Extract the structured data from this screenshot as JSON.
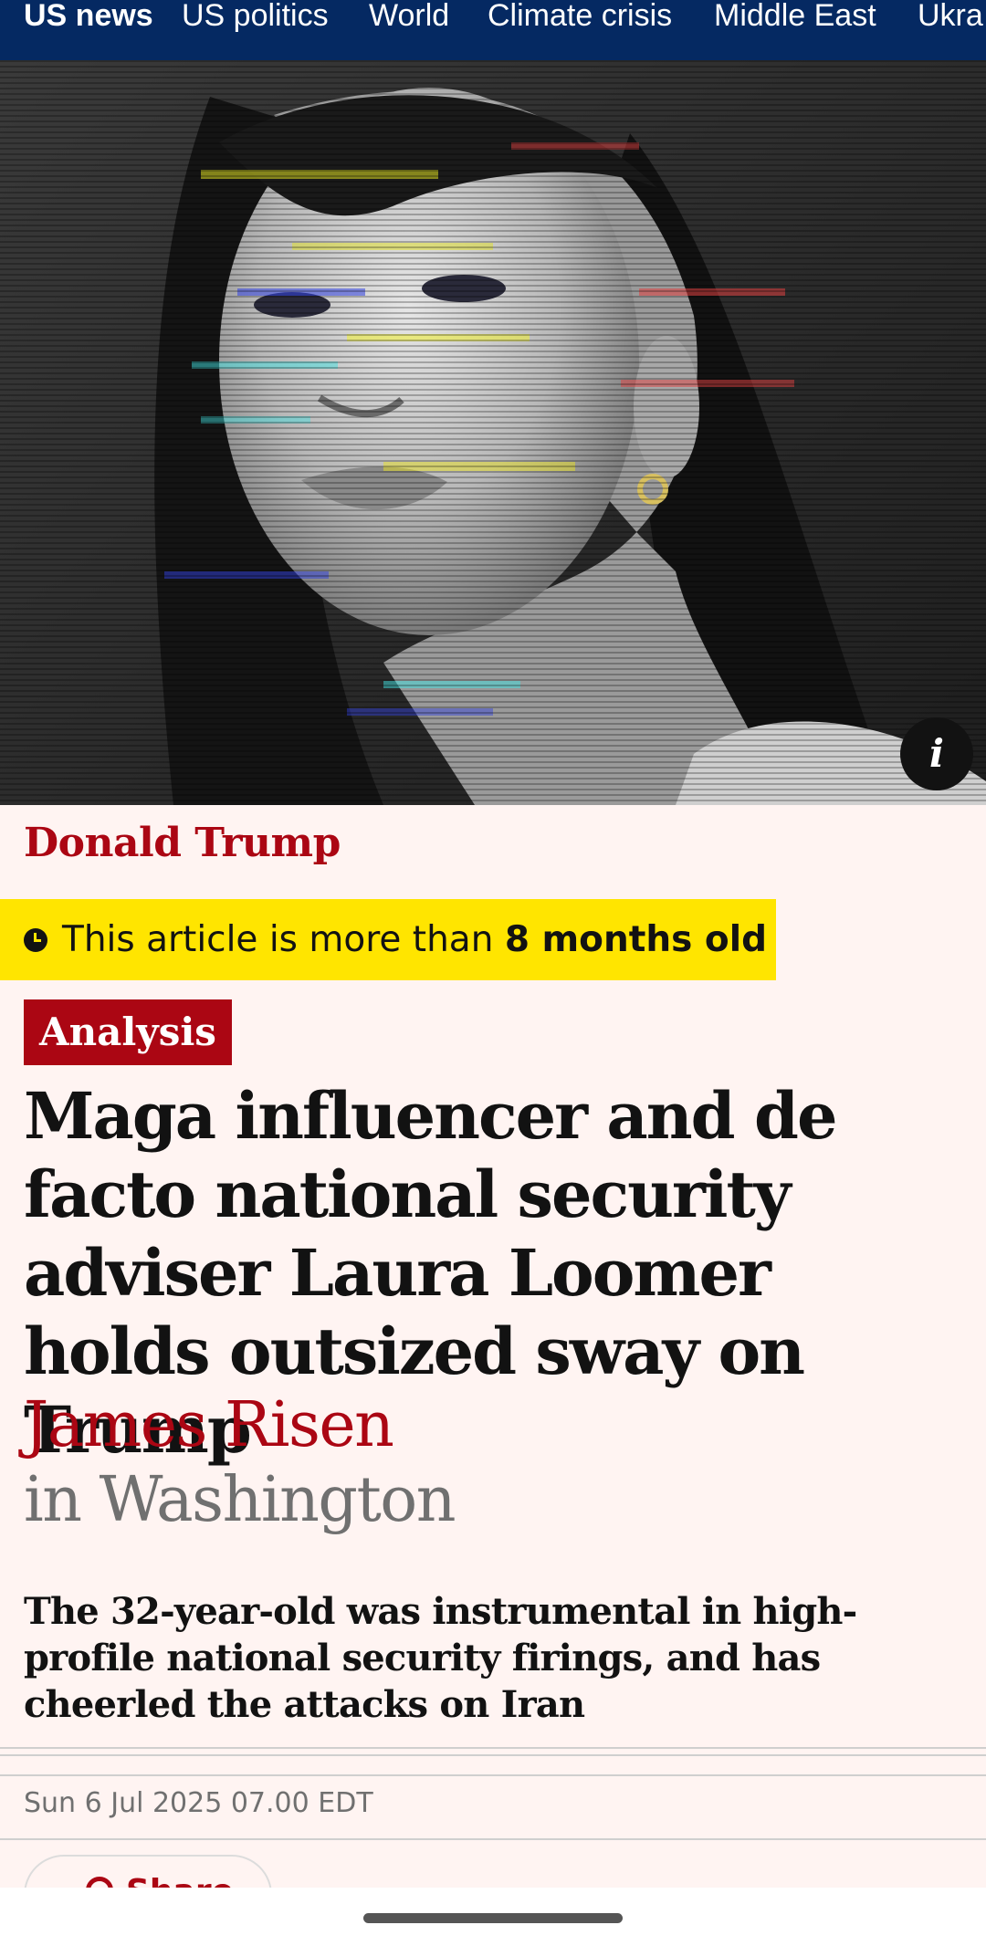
{
  "nav": {
    "items": [
      {
        "label": "US news",
        "active": true
      },
      {
        "label": "US politics",
        "active": false
      },
      {
        "label": "World",
        "active": false
      },
      {
        "label": "Climate crisis",
        "active": false
      },
      {
        "label": "Middle East",
        "active": false
      },
      {
        "label": "Ukra",
        "active": false
      }
    ]
  },
  "hero": {
    "info_icon": "i"
  },
  "article": {
    "kicker": "Donald Trump",
    "age_notice": {
      "prefix": "This article is more than ",
      "emphasis": "8 months old",
      "icon": "clock-icon"
    },
    "label": "Analysis",
    "headline": "Maga influencer and de facto national security adviser Laura Loomer holds outsized sway on Trump",
    "author": "James Risen",
    "location": "in Washington",
    "standfirst": "The 32-year-old was instrumental in high-profile national security firings, and has cheerled the attacks on Iran",
    "dateline": "Sun 6 Jul 2025 07.00 EDT",
    "share_label": "Share",
    "share_icon": "share-icon"
  },
  "colors": {
    "nav_background": "#052962",
    "page_background": "#fff4f2",
    "accent_red": "#ab0613",
    "age_banner": "#ffe500",
    "text": "#121212",
    "muted": "#707070"
  }
}
